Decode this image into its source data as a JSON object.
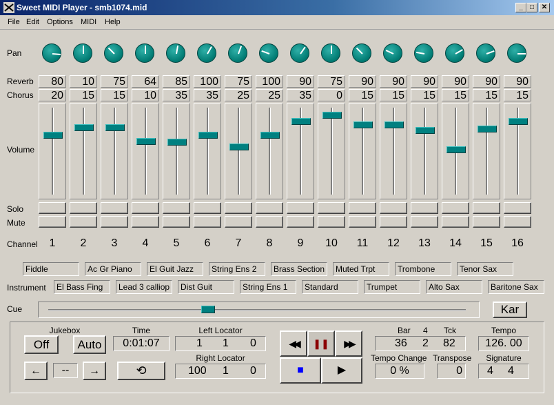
{
  "window": {
    "title": "Sweet MIDI Player - smb1074.mid",
    "minimize": "_",
    "maximize": "□",
    "close": "✕"
  },
  "menu": [
    "File",
    "Edit",
    "Options",
    "MIDI",
    "Help"
  ],
  "labels": {
    "pan": "Pan",
    "reverb": "Reverb",
    "chorus": "Chorus",
    "volume": "Volume",
    "solo": "Solo",
    "mute": "Mute",
    "channel": "Channel",
    "instrument": "Instrument",
    "cue": "Cue"
  },
  "channels": [
    {
      "num": "1",
      "pan_angle": 95,
      "reverb": "80",
      "chorus": "20",
      "volume": 0.7
    },
    {
      "num": "2",
      "pan_angle": 0,
      "reverb": "10",
      "chorus": "15",
      "volume": 0.79
    },
    {
      "num": "3",
      "pan_angle": -45,
      "reverb": "75",
      "chorus": "15",
      "volume": 0.79
    },
    {
      "num": "4",
      "pan_angle": 0,
      "reverb": "64",
      "chorus": "10",
      "volume": 0.62
    },
    {
      "num": "5",
      "pan_angle": 10,
      "reverb": "85",
      "chorus": "35",
      "volume": 0.61
    },
    {
      "num": "6",
      "pan_angle": 30,
      "reverb": "100",
      "chorus": "35",
      "volume": 0.7
    },
    {
      "num": "7",
      "pan_angle": 20,
      "reverb": "75",
      "chorus": "25",
      "volume": 0.55
    },
    {
      "num": "8",
      "pan_angle": -70,
      "reverb": "100",
      "chorus": "25",
      "volume": 0.7
    },
    {
      "num": "9",
      "pan_angle": 35,
      "reverb": "90",
      "chorus": "35",
      "volume": 0.87
    },
    {
      "num": "10",
      "pan_angle": 0,
      "reverb": "75",
      "chorus": "0",
      "volume": 0.95
    },
    {
      "num": "11",
      "pan_angle": -45,
      "reverb": "90",
      "chorus": "15",
      "volume": 0.83
    },
    {
      "num": "12",
      "pan_angle": -65,
      "reverb": "90",
      "chorus": "15",
      "volume": 0.83
    },
    {
      "num": "13",
      "pan_angle": -80,
      "reverb": "90",
      "chorus": "15",
      "volume": 0.76
    },
    {
      "num": "14",
      "pan_angle": 60,
      "reverb": "90",
      "chorus": "15",
      "volume": 0.52
    },
    {
      "num": "15",
      "pan_angle": 70,
      "reverb": "90",
      "chorus": "15",
      "volume": 0.78
    },
    {
      "num": "16",
      "pan_angle": 90,
      "reverb": "90",
      "chorus": "15",
      "volume": 0.87
    }
  ],
  "instruments": [
    "Fiddle",
    "El Bass Fing",
    "Ac Gr Piano",
    "Lead 3 calliop",
    "El Guit Jazz",
    "Dist Guit",
    "String Ens 2",
    "String Ens 1",
    "Brass Section",
    "Standard",
    "Muted Trpt",
    "Trumpet",
    "Trombone",
    "Alto Sax",
    "Tenor Sax",
    "Baritone Sax"
  ],
  "cue": {
    "position": 0.37,
    "karaoke_label": "Kar"
  },
  "jukebox": {
    "label": "Jukebox",
    "off_label": "Off",
    "auto_label": "Auto",
    "prev_label": "←",
    "track_value": "--",
    "next_label": "→"
  },
  "time": {
    "label": "Time",
    "value": "0:01:07",
    "loop_icon": "⟲"
  },
  "left_locator": {
    "label": "Left Locator",
    "bar": "1",
    "beat": "1",
    "tick": "0"
  },
  "right_locator": {
    "label": "Right Locator",
    "bar": "100",
    "beat": "1",
    "tick": "0"
  },
  "transport": {
    "rewind": "◀◀",
    "pause": "❚❚",
    "forward": "▶▶",
    "stop": "■",
    "play": "▶"
  },
  "position": {
    "bar_label": "Bar",
    "beat_label": "4",
    "tick_label": "Tck",
    "bar": "36",
    "beat": "2",
    "tick": "82"
  },
  "tempo": {
    "label": "Tempo",
    "value": "126. 00"
  },
  "tempo_change": {
    "label": "Tempo Change",
    "value": "0 %"
  },
  "transpose": {
    "label": "Transpose",
    "value": "0"
  },
  "signature": {
    "label": "Signature",
    "num": "4",
    "den": "4"
  },
  "colors": {
    "title_start": "#0a246a",
    "knob": "#008080",
    "fader_thumb": "#008080",
    "pause": "#8b0000",
    "stop": "#0000ff"
  }
}
